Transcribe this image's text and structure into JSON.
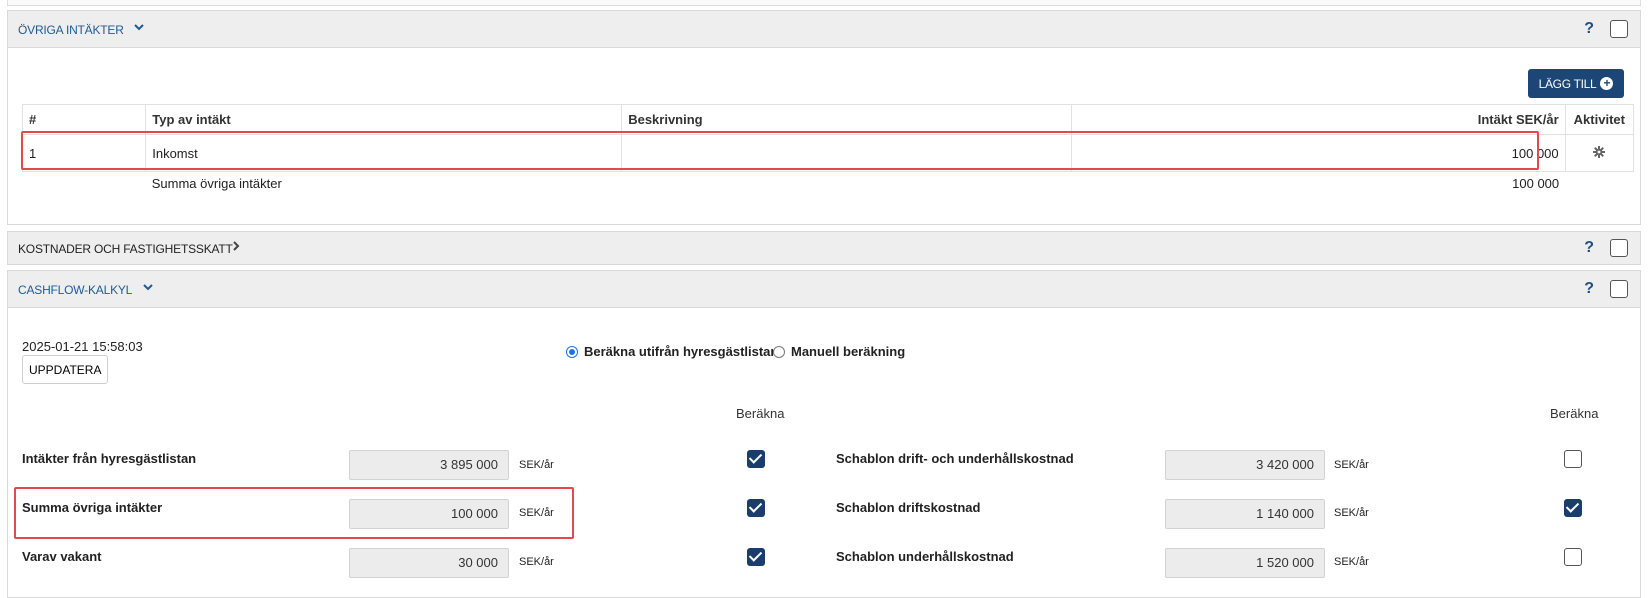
{
  "ovriga": {
    "title": "ÖVRIGA INTÄKTER",
    "help": "?",
    "add_button": "LÄGG TILL",
    "columns": [
      "#",
      "Typ av intäkt",
      "Beskrivning",
      "Intäkt SEK/år",
      "Aktivitet"
    ],
    "rows": [
      {
        "num": "1",
        "type": "Inkomst",
        "description": "",
        "amount": "100 000",
        "activity_icon": "gear-icon"
      }
    ],
    "sum_label": "Summa övriga intäkter",
    "sum_value": "100 000"
  },
  "kostnader": {
    "title": "KOSTNADER OCH FASTIGHETSSKATT",
    "help": "?"
  },
  "cashflow": {
    "title": "CASHFLOW-KALKYL",
    "help": "?",
    "timestamp": "2025-01-21 15:58:03",
    "update_button": "UPPDATERA",
    "radio_auto": "Beräkna utifrån hyresgästlistan",
    "radio_manual": "Manuell beräkning",
    "calc_header": "Beräkna",
    "left_rows": [
      {
        "label": "Intäkter från hyresgästlistan",
        "value": "3 895 000",
        "unit": "SEK/år",
        "checked": true
      },
      {
        "label": "Summa övriga intäkter",
        "value": "100 000",
        "unit": "SEK/år",
        "checked": true
      },
      {
        "label": "Varav vakant",
        "value": "30 000",
        "unit": "SEK/år",
        "checked": true
      }
    ],
    "right_rows": [
      {
        "label": "Schablon drift- och underhållskostnad",
        "value": "3 420 000",
        "unit": "SEK/år",
        "checked": false
      },
      {
        "label": "Schablon driftskostnad",
        "value": "1 140 000",
        "unit": "SEK/år",
        "checked": true
      },
      {
        "label": "Schablon underhållskostnad",
        "value": "1 520 000",
        "unit": "SEK/år",
        "checked": false
      }
    ]
  },
  "colors": {
    "accent": "#1b4675",
    "highlight": "#e34a4a",
    "header_bg": "#eeeeee"
  }
}
